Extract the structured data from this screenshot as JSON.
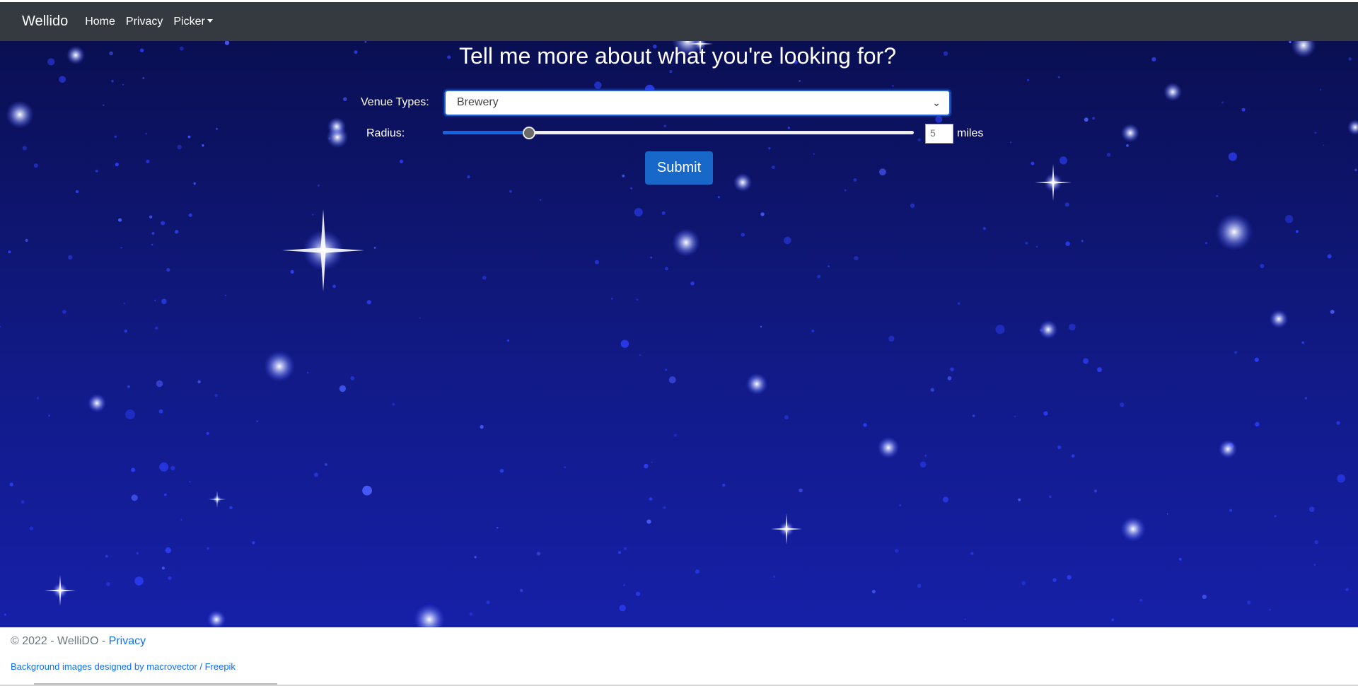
{
  "navbar": {
    "brand": "Wellido",
    "links": [
      "Home",
      "Privacy"
    ],
    "picker_label": "Picker"
  },
  "main": {
    "heading": "Tell me more about what you're looking for?",
    "venue_label": "Venue Types:",
    "venue_selected": "Brewery",
    "radius_label": "Radius:",
    "radius_value": "5",
    "radius_fraction": 0.175,
    "radius_unit": "miles",
    "submit_label": "Submit"
  },
  "footer": {
    "copyright": "© 2022 - WelliDO - ",
    "privacy_link": "Privacy",
    "credit": "Background images designed by macrovector / Freepik"
  },
  "colors": {
    "navbar": "#343a40",
    "sky_top": "#0a0f52",
    "sky_bottom": "#1620a8",
    "accent": "#1565e0",
    "link": "#0d6efd"
  }
}
